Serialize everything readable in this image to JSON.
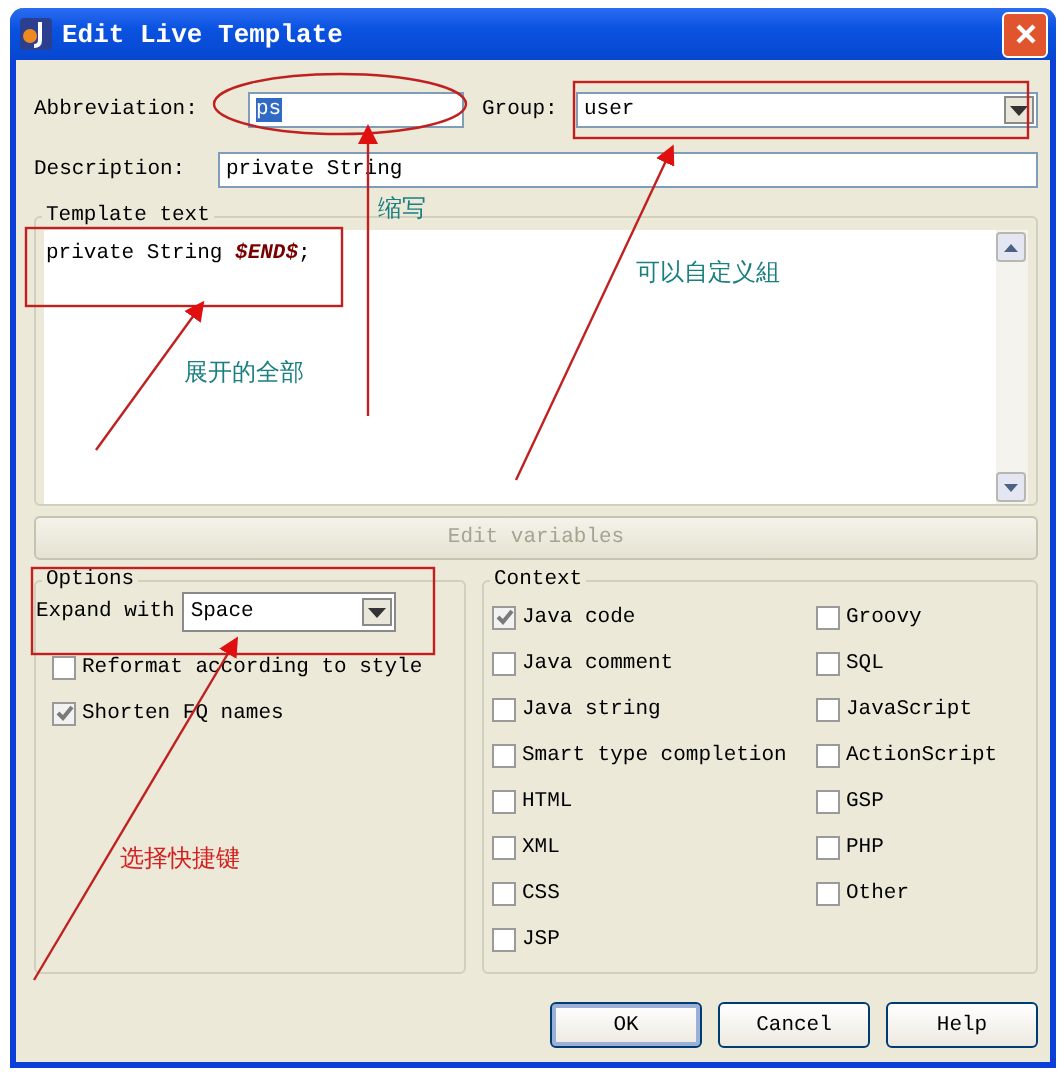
{
  "window": {
    "title": "Edit Live Template"
  },
  "abbreviation": {
    "label": "Abbreviation:",
    "value": "ps",
    "text_selected": true
  },
  "group": {
    "label": "Group:",
    "value": "user"
  },
  "description": {
    "label": "Description:",
    "value": "private String"
  },
  "template_text": {
    "title": "Template text",
    "segments": [
      {
        "text": "private String ",
        "kind": "plain"
      },
      {
        "text": "$END$",
        "kind": "variable"
      },
      {
        "text": ";",
        "kind": "plain"
      }
    ]
  },
  "edit_variables": {
    "label": "Edit variables",
    "disabled": true
  },
  "options": {
    "title": "Options",
    "expand_with": {
      "label": "Expand with",
      "value": "Space"
    },
    "checkboxes": [
      {
        "label": "Reformat according to style",
        "checked": false
      },
      {
        "label": "Shorten FQ names",
        "checked": true
      }
    ]
  },
  "context": {
    "title": "Context",
    "columns": [
      {
        "items": [
          {
            "label": "Java code",
            "checked": true
          },
          {
            "label": "Java comment",
            "checked": false
          },
          {
            "label": "Java string",
            "checked": false
          },
          {
            "label": "Smart type completion",
            "checked": false
          },
          {
            "label": "HTML",
            "checked": false
          },
          {
            "label": "XML",
            "checked": false
          },
          {
            "label": "CSS",
            "checked": false
          },
          {
            "label": "JSP",
            "checked": false
          }
        ]
      },
      {
        "items": [
          {
            "label": "Groovy",
            "checked": false
          },
          {
            "label": "SQL",
            "checked": false
          },
          {
            "label": "JavaScript",
            "checked": false
          },
          {
            "label": "ActionScript",
            "checked": false
          },
          {
            "label": "GSP",
            "checked": false
          },
          {
            "label": "PHP",
            "checked": false
          },
          {
            "label": "Other",
            "checked": false
          }
        ]
      }
    ]
  },
  "buttons": [
    {
      "label": "OK",
      "default": true
    },
    {
      "label": "Cancel",
      "default": false
    },
    {
      "label": "Help",
      "default": false
    }
  ],
  "annotation_shapes": [
    {
      "kind": "ellipse"
    },
    {
      "kind": "arrow"
    },
    {
      "kind": "frame"
    },
    {
      "kind": "arrow"
    },
    {
      "kind": "frame"
    },
    {
      "kind": "arrow"
    },
    {
      "kind": "frame"
    },
    {
      "kind": "arrow"
    }
  ],
  "annotations": [
    {
      "text": "缩写",
      "color": "#1a7f80"
    },
    {
      "text": "可以自定义組",
      "color": "#1a7f80"
    },
    {
      "text": "展开的全部",
      "color": "#1a7f80"
    },
    {
      "text": "选择快捷键",
      "color": "#d42020"
    }
  ]
}
